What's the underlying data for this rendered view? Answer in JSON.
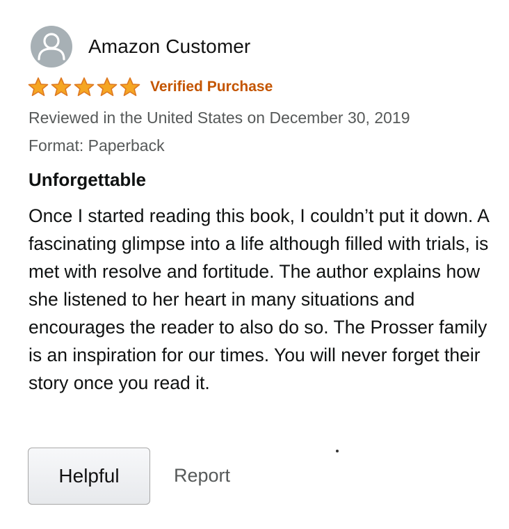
{
  "reviewer": {
    "name": "Amazon Customer",
    "avatar_icon": "user-avatar-icon"
  },
  "rating": {
    "stars": 5,
    "max_stars": 5,
    "star_color": "#f5a623",
    "verified_label": "Verified Purchase",
    "verified_color": "#c45500"
  },
  "meta": {
    "date_line": "Reviewed in the United States on December 30, 2019",
    "format_line": "Format: Paperback"
  },
  "review": {
    "title": "Unforgettable",
    "body": "Once I started reading this book, I couldn’t put it down. A fascinating glimpse into a life although filled with trials, is met with resolve and fortitude. The author explains how she listened to her heart in many situations and encourages the reader to also do so. The Prosser family is an inspiration for our times. You will never forget their story once you read it."
  },
  "actions": {
    "helpful_label": "Helpful",
    "report_label": "Report"
  }
}
